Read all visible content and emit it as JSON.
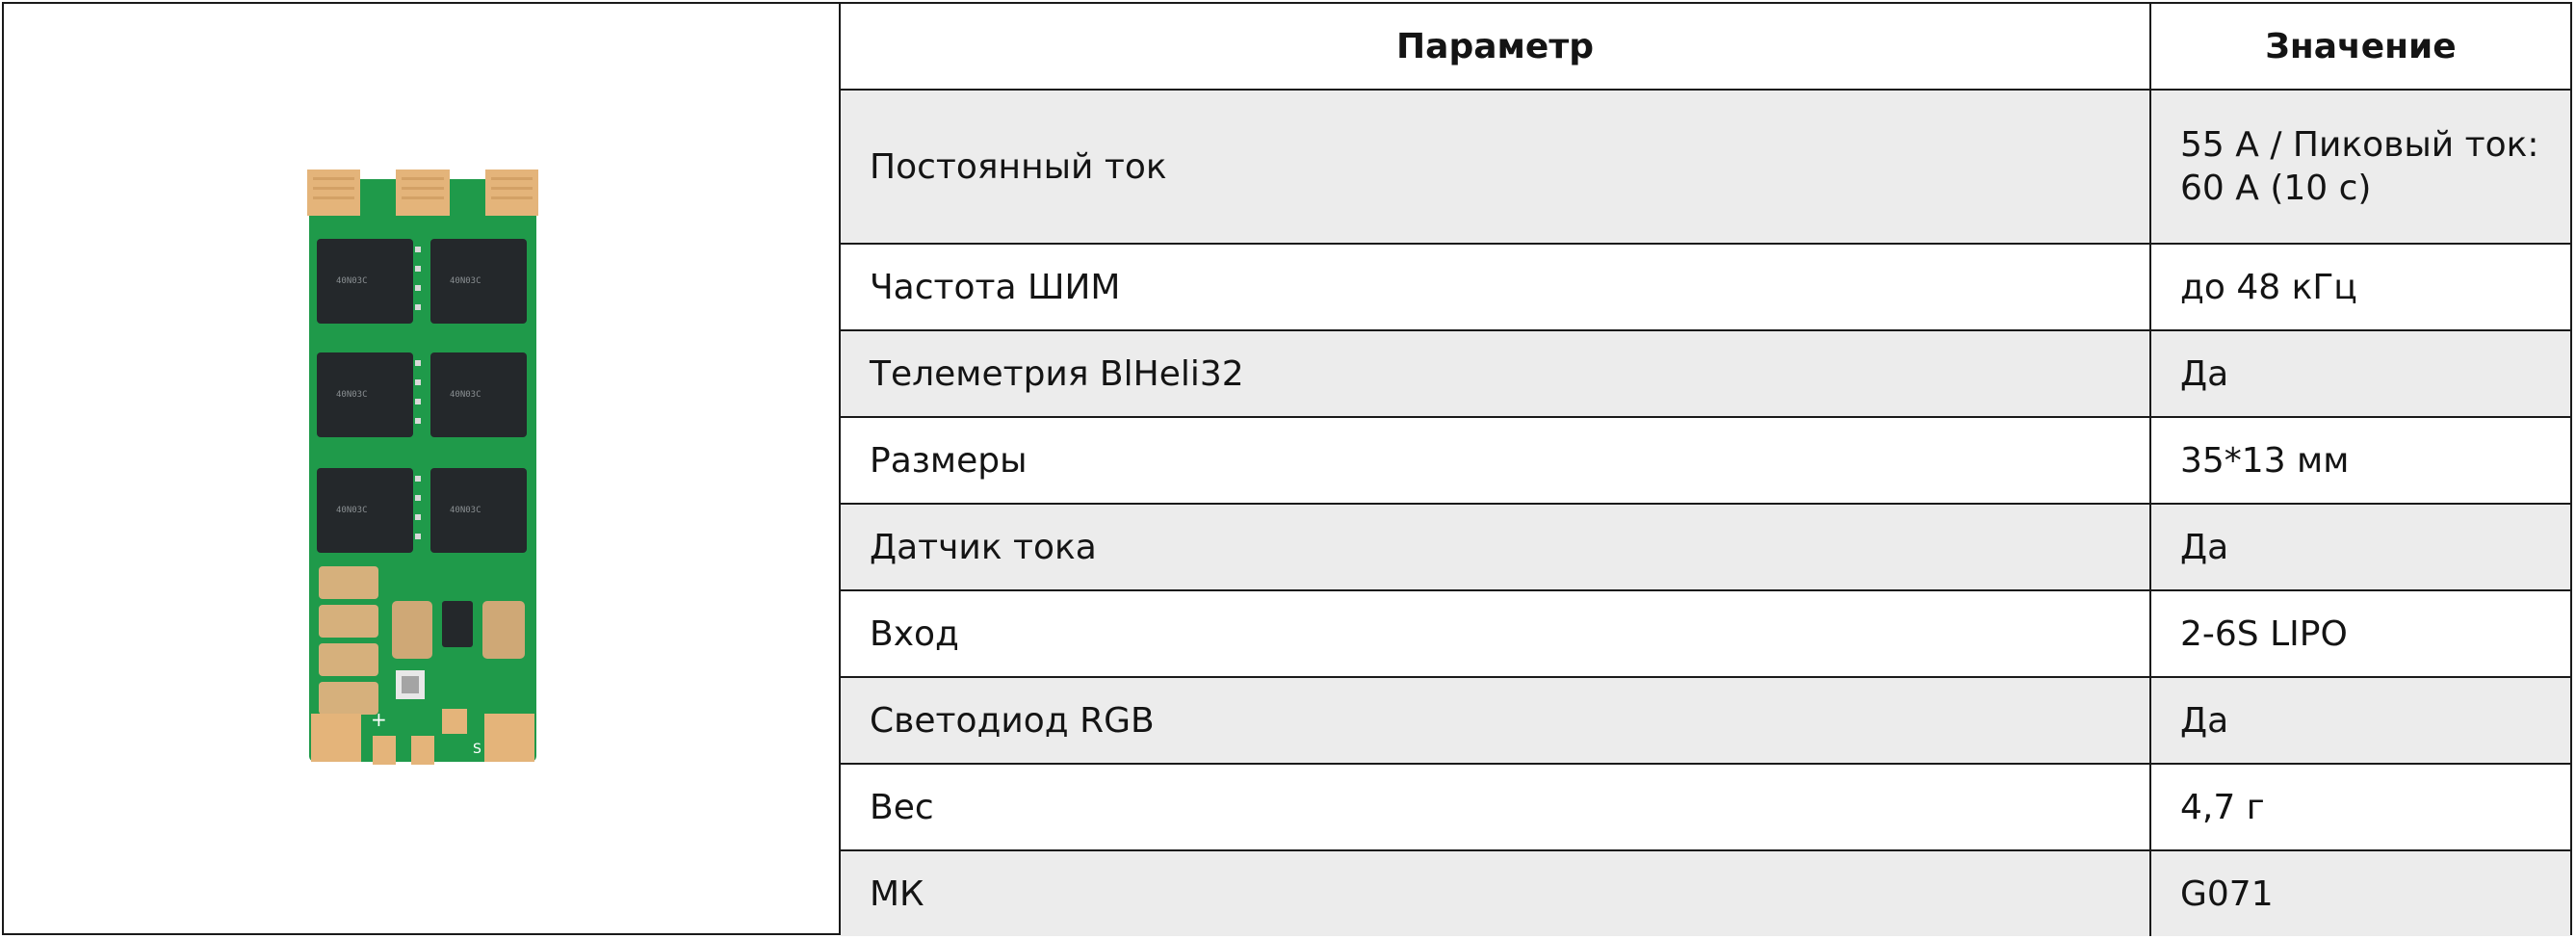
{
  "image": {
    "alt": "ESC board"
  },
  "table": {
    "headers": [
      "Параметр",
      "Значение"
    ],
    "rows": [
      {
        "param": "Постоянный ток",
        "value": "55 А / Пиковый ток: 60 А (10 с)"
      },
      {
        "param": "Частота ШИМ",
        "value": "до 48 кГц"
      },
      {
        "param": "Телеметрия BlHeli32",
        "value": "Да"
      },
      {
        "param": "Размеры",
        "value": "35*13 мм"
      },
      {
        "param": "Датчик тока",
        "value": "Да"
      },
      {
        "param": "Вход",
        "value": "2-6S LIPO"
      },
      {
        "param": "Светодиод RGB",
        "value": "Да"
      },
      {
        "param": "Вес",
        "value": "4,7 г"
      },
      {
        "param": "МК",
        "value": "G071"
      }
    ]
  },
  "colors": {
    "border": "#1a1a1a",
    "row_shade": "#ececec",
    "pcb_green": "#1f9a4a",
    "pad_gold": "#e4b47a",
    "chip_black": "#24282b"
  }
}
